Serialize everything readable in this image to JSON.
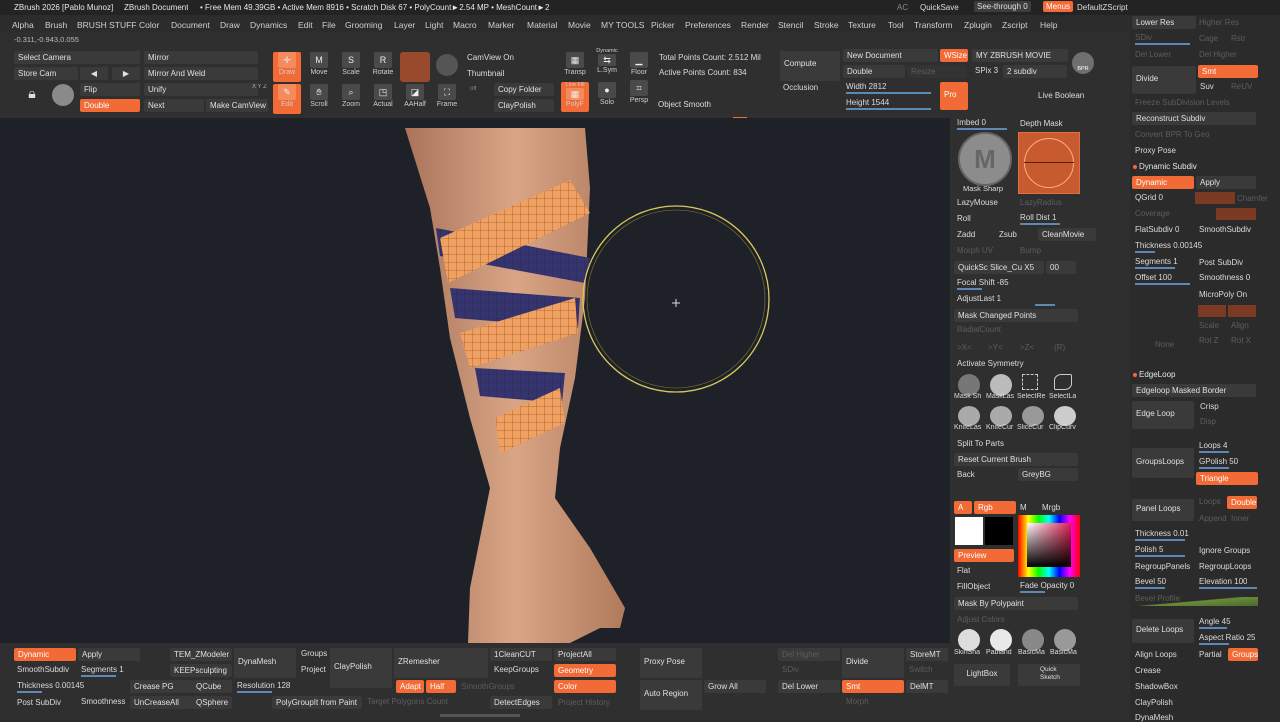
{
  "titlebar": {
    "app": "ZBrush 2026 [Pablo Munoz]",
    "doc": "ZBrush Document",
    "stats": "• Free Mem 49.39GB • Active Mem 8916 • Scratch Disk 67 • PolyCount►2.54 MP • MeshCount►2",
    "ac": "AC",
    "quicksave": "QuickSave",
    "seethrough": "See-through 0",
    "menus": "Menus",
    "defaultscript": "DefaultZScript"
  },
  "menus": [
    "Alpha",
    "Brush",
    "BRUSH STUFF",
    "Color",
    "Document",
    "Draw",
    "Dynamics",
    "Edit",
    "File",
    "Grooming",
    "Layer",
    "Light",
    "Macro",
    "Marker",
    "Material",
    "Movie",
    "MY TOOLS",
    "Picker",
    "Preferences",
    "Render",
    "Stencil",
    "Stroke",
    "Texture",
    "Tool",
    "Transform",
    "Zplugin",
    "Zscript",
    "Help"
  ],
  "coords": "-0.311,-0.943,0.055",
  "shelf": {
    "select_camera": "Select Camera",
    "store_cam": "Store Cam",
    "mirror": "Mirror",
    "mirror_weld": "Mirror And Weld",
    "flip": "Flip",
    "unify": "Unify",
    "double": "Double",
    "next": "Next",
    "make_camview": "Make CamView",
    "xyz": "X Y Z",
    "draw": "Draw",
    "move": "Move",
    "scale": "Scale",
    "rotate": "Rotate",
    "edit": "Edit",
    "scroll": "Scroll",
    "zoom": "Zoom",
    "actual": "Actual",
    "aahalf": "AAHalf",
    "frame": "Frame",
    "camview_on": "CamView On",
    "thumbnail": "Thumbnail",
    "copy_folder": "Copy Folder",
    "claypolish": "ClayPolish",
    "off": "off",
    "transp": "Transp",
    "dynamic": "Dynamic",
    "lsym": "L.Sym",
    "floor": "Floor",
    "linefill": "Line Fill",
    "polyf": "PolyF",
    "solo": "Solo",
    "persp": "Persp",
    "object_smooth": "Object Smooth",
    "total_points": "Total Points Count: 2.512 Mil",
    "active_points": "Active Points Count: 834",
    "compute": "Compute",
    "occlusion": "Occlusion",
    "new_document": "New Document",
    "wsize": "WSize",
    "double2": "Double",
    "resize": "Resize",
    "width": "Width 2812",
    "height": "Height 1544",
    "pro": "Pro",
    "my_zbrush_movie": "MY ZBRUSH MOVIE",
    "spix": "SPix 3",
    "subdiv": "2 subdiv",
    "bpr": "BPR",
    "live_boolean": "Live Boolean"
  },
  "rightmid": {
    "imbed": "Imbed 0",
    "depth_mask": "Depth Mask",
    "mask_sharp": "Mask Sharp",
    "lazymouse": "LazyMouse",
    "lazyradius": "LazyRadius",
    "roll": "Roll",
    "roll_dist": "Roll Dist 1",
    "zadd": "Zadd",
    "zsub": "Zsub",
    "cleanmovie": "CleanMovie",
    "morph_uv": "Morph UV",
    "bump": "Bump",
    "quicksc": "QuickSc Slice_Cu X5",
    "quick_val": "00",
    "focal_shift": "Focal Shift -85",
    "adjustlast": "AdjustLast 1",
    "mask_changed": "Mask Changed Points",
    "radialcount": "RadialCount",
    "sym_x": ">X<",
    "sym_y": ">Y<",
    "sym_z": ">Z<",
    "sym_r": "(R)",
    "activate_symmetry": "Activate Symmetry",
    "tools": [
      "Mask Sh",
      "MaskLas",
      "SelectRe",
      "SelectLa",
      "KnifeLas",
      "KnifeCur",
      "SliceCur",
      "ClipCurv"
    ],
    "split_to_parts": "Split To Parts",
    "reset_brush": "Reset Current Brush",
    "back": "Back",
    "greybg": "GreyBG",
    "a": "A",
    "rgb": "Rgb",
    "m": "M",
    "mrgb": "Mrgb",
    "preview": "Preview",
    "flat": "Flat",
    "fillobject": "FillObject",
    "fade_opacity": "Fade Opacity 0",
    "mask_by_polypaint": "Mask By Polypaint",
    "adjust_colors": "Adjust Colors",
    "materials": [
      "SkinSha",
      "Pabland",
      "BasicMa",
      "BasicMa"
    ],
    "lightbox": "LightBox",
    "quick_sketch": "Quick Sketch"
  },
  "rightpanel": {
    "lower_res": "Lower Res",
    "higher_res": "Higher Res",
    "sdiv": "SDiv",
    "cage": "Cage",
    "rstr": "Rstr",
    "del_lower": "Del Lower",
    "del_higher": "Del Higher",
    "divide": "Divide",
    "smt": "Smt",
    "suv": "Suv",
    "reuv": "ReUV",
    "freeze": "Freeze SubDivision Levels",
    "reconstruct": "Reconstruct Subdiv",
    "convert_bpr": "Convert BPR To Geo",
    "proxy_pose": "Proxy Pose",
    "dynamic_subdiv": "Dynamic Subdiv",
    "dynamic": "Dynamic",
    "apply": "Apply",
    "qgrid": "QGrid 0",
    "chamfer": "Chamfer",
    "coverage": "Coverage",
    "flatsubdiv": "FlatSubdiv 0",
    "smoothsubdiv": "SmoothSubdiv",
    "thickness": "Thickness 0.00145",
    "segments": "Segments 1",
    "post_subdiv": "Post SubDiv",
    "offset": "Offset 100",
    "smoothness": "Smoothness 0",
    "micropoly": "MicroPoly On",
    "scale": "Scale",
    "align": "Align",
    "rot_z": "Rot Z",
    "rot_x": "Rot X",
    "none": "None",
    "edgeloop": "EdgeLoop",
    "edgeloop_masked": "Edgeloop Masked Border",
    "edge_loop": "Edge Loop",
    "crisp": "Crisp",
    "disp": "Disp",
    "groupsloops": "GroupsLoops",
    "loops": "Loops 4",
    "gpolish": "GPolish 50",
    "triangle": "Triangle",
    "panel_loops": "Panel Loops",
    "loops2": "Loops",
    "double": "Double",
    "append": "Append",
    "inner": "Inner",
    "thickness2": "Thickness 0.01",
    "polish": "Polish 5",
    "ignore_groups": "Ignore Groups",
    "regrouppanels": "RegroupPanels",
    "regrouploops": "RegroupLoops",
    "bevel": "Bevel 50",
    "elevation": "Elevation 100",
    "bevel_profile": "Bevel Profile",
    "delete_loops": "Delete Loops",
    "angle": "Angle 45",
    "aspect_ratio": "Aspect Ratio 25",
    "align_loops": "Align Loops",
    "partial": "Partial",
    "groups": "Groups",
    "crease": "Crease",
    "shadowbox": "ShadowBox",
    "claypolish": "ClayPolish",
    "dynamesh": "DynaMesh"
  },
  "bottom": {
    "dynamic": "Dynamic",
    "apply": "Apply",
    "tem_zmodeler": "TEM_ZModeler",
    "dynamesh": "DynaMesh",
    "groups": "Groups",
    "project": "Project",
    "claypolish": "ClayPolish",
    "zremesher": "ZRemesher",
    "onecleancut": "1CleanCUT",
    "projectall": "ProjectAll",
    "smoothsubdiv": "SmoothSubdiv",
    "segments": "Segments 1",
    "keepsculpting": "KEEPsculpting",
    "keepgroups": "KeepGroups",
    "geometry": "Geometry",
    "thickness": "Thickness 0.00145",
    "crease_pg": "Crease PG",
    "qcube": "QCube",
    "resolution": "Resolution 128",
    "adapt": "Adapt",
    "half": "Half",
    "smoothgroups": "SmoothGroups",
    "color": "Color",
    "post_subdiv": "Post SubDiv",
    "smoothness": "Smoothness",
    "uncreaseall": "UnCreaseAll",
    "qsphere": "QSphere",
    "polygroupit": "PolyGroupIt from Paint",
    "target_polygons": "Target Polygons Count",
    "detectedges": "DetectEdges",
    "project_history": "Project History",
    "proxy_pose": "Proxy Pose",
    "auto_region": "Auto Region",
    "grow_all": "Grow All",
    "del_higher": "Del Higher",
    "sdiv": "SDiv",
    "del_lower": "Del Lower",
    "divide": "Divide",
    "smt": "Smt",
    "storemt": "StoreMT",
    "switch": "Switch",
    "delmt": "DelMT",
    "morph": "Morph"
  },
  "colors": {
    "accent": "#f26a35",
    "panel": "#2f2f2f",
    "canvas": "#1f2128",
    "band_orange": "#f0a060",
    "band_blue": "#35346e",
    "brush_ring": "#d8c860"
  }
}
